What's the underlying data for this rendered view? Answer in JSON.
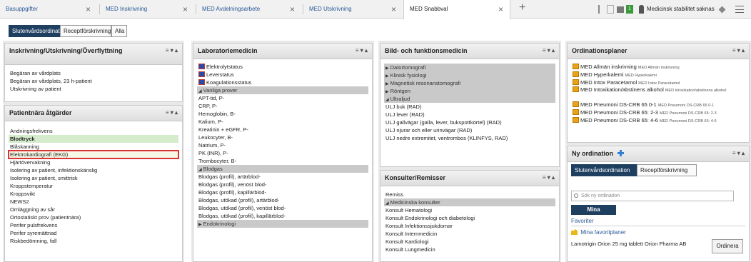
{
  "tabs": [
    {
      "label": "Basuppgifter",
      "active": false
    },
    {
      "label": "MED Inskrivning",
      "active": false
    },
    {
      "label": "MED Avdelningsarbete",
      "active": false
    },
    {
      "label": "MED Utskrivning",
      "active": false
    },
    {
      "label": "MED Snabbval",
      "active": true
    }
  ],
  "status": {
    "badge_count": "1",
    "text": "Medicinsk stabilitet saknas"
  },
  "filters": [
    "Slutenvårdsordination",
    "Receptförskrivning",
    "Alla"
  ],
  "panel_controls": "≡ ▾ ▴",
  "inskrivning": {
    "title": "Inskrivning/Utskrivning/Överflyttning",
    "items": [
      "Begäran av vårdplats",
      "Begäran av vårdplats, 23 h-patient",
      "Utskrivning av patient"
    ]
  },
  "patientnara": {
    "title": "Patientnära åtgärder",
    "items": [
      "Andningsfrekvens",
      "Blodtryck",
      "Blåskanning",
      "Elektrokardiografi (EKG)",
      "Hjärtövervakning",
      "Isolering av patient, infektionskänslig",
      "Isolering av patient, smittrisk",
      "Kroppstemperatur",
      "Kroppsvikt",
      "NEWS2",
      "Omläggning av sår",
      "Ortostatiskt prov (patientnära)",
      "Perifer pulsfrekvens",
      "Perifer syremättnad",
      "Riskbedömning, fall"
    ]
  },
  "lab": {
    "title": "Laboratoriemedicin",
    "items": [
      {
        "text": "Elektrolytstatus",
        "kind": "icon"
      },
      {
        "text": "Leverstatus",
        "kind": "icon"
      },
      {
        "text": "Koagulationsstatus",
        "kind": "icon"
      },
      {
        "text": "Vanliga prover",
        "kind": "group"
      },
      {
        "text": "APT-tid, P-",
        "kind": "item"
      },
      {
        "text": "CRP, P-",
        "kind": "item"
      },
      {
        "text": "Hemoglobin, B-",
        "kind": "item"
      },
      {
        "text": "Kalium, P-",
        "kind": "item"
      },
      {
        "text": "Kreatinin + eGFR, P-",
        "kind": "item"
      },
      {
        "text": "Leukocyter, B-",
        "kind": "item"
      },
      {
        "text": "Natrium, P-",
        "kind": "item"
      },
      {
        "text": "PK (INR), P-",
        "kind": "item"
      },
      {
        "text": "Trombocyter, B-",
        "kind": "item"
      },
      {
        "text": "Blodgas",
        "kind": "group"
      },
      {
        "text": "Blodgas (profil), artärblod-",
        "kind": "item"
      },
      {
        "text": "Blodgas (profil), venöst blod-",
        "kind": "item"
      },
      {
        "text": "Blodgas (profil), kapillärblod-",
        "kind": "item"
      },
      {
        "text": "Blodgas, utökad (profil), artärblod-",
        "kind": "item"
      },
      {
        "text": "Blodgas, utökad (profil), venöst blod-",
        "kind": "item"
      },
      {
        "text": "Blodgas, utökad (profil), kapillärblod-",
        "kind": "item"
      },
      {
        "text": "Endokrinologi",
        "kind": "group-collapsed"
      }
    ]
  },
  "bild": {
    "title": "Bild- och funktionsmedicin",
    "items": [
      {
        "text": "Datortomografi",
        "kind": "group-collapsed"
      },
      {
        "text": "Klinisk fysiologi",
        "kind": "group-collapsed"
      },
      {
        "text": "Magnetisk resonanstomografi",
        "kind": "group-collapsed"
      },
      {
        "text": "Röntgen",
        "kind": "group-collapsed"
      },
      {
        "text": "Ultraljud",
        "kind": "group"
      },
      {
        "text": "ULJ buk (RAD)",
        "kind": "item"
      },
      {
        "text": "ULJ lever (RAD)",
        "kind": "item"
      },
      {
        "text": "ULJ gallvägar (galla, lever, bukspottkörtel) (RAD)",
        "kind": "item"
      },
      {
        "text": "ULJ njurar och eller urinvägar (RAD)",
        "kind": "item"
      },
      {
        "text": "ULJ nedre extremitet, ventrombos (KLINFYS, RAD)",
        "kind": "item"
      }
    ]
  },
  "konsulter": {
    "title": "Konsulter/Remisser",
    "items": [
      {
        "text": "Remiss",
        "kind": "item"
      },
      {
        "text": "Medicinska konsulter",
        "kind": "group"
      },
      {
        "text": "Konsult Hematologi",
        "kind": "item"
      },
      {
        "text": "Konsult Endokrinologi och diabetologi",
        "kind": "item"
      },
      {
        "text": "Konsult Infektionssjukdomar",
        "kind": "item"
      },
      {
        "text": "Konsult Internmedicin",
        "kind": "item"
      },
      {
        "text": "Konsult Kardiologi",
        "kind": "item"
      },
      {
        "text": "Konsult Lungmedicin",
        "kind": "item"
      }
    ]
  },
  "ordplaner": {
    "title": "Ordinationsplaner",
    "items": [
      {
        "name": "MED Allmän inskrivning",
        "sub": "MED Allmän inskrivning"
      },
      {
        "name": "MED Hyperkalemi",
        "sub": "MED Hyperkalemi"
      },
      {
        "name": "MED Intox Paracetamol",
        "sub": "MED Intox Paracetamol"
      },
      {
        "name": "MED Intoxikation/abstinens alkohol",
        "sub": "MED Intoxikation/abstinens alkohol"
      },
      {
        "name": "MED Pneumoni DS-CRB 65 0-1",
        "sub": "MED Pneumoni DS-CRB 65 0-1"
      },
      {
        "name": "MED Pneumoni DS-CRB 65: 2-3",
        "sub": "MED Pneumoni DS-CRB 65: 2-3"
      },
      {
        "name": "MED Pneumoni DS-CRB 65: 4-6",
        "sub": "MED Pneumoni DS-CRB 65: 4-6"
      }
    ]
  },
  "nyord": {
    "title": "Ny ordination",
    "tabs": [
      "Slutenvårdsordination",
      "Receptförskrivning"
    ],
    "search_placeholder": "Sök ny ordination",
    "mina": "Mina",
    "favoriter": "Favoriter",
    "favoritplaner": "Mina favoritplaner",
    "medication": "Lamotrigin Orion 25 mg tablett Orion Pharma AB",
    "ordinera": "Ordinera"
  }
}
